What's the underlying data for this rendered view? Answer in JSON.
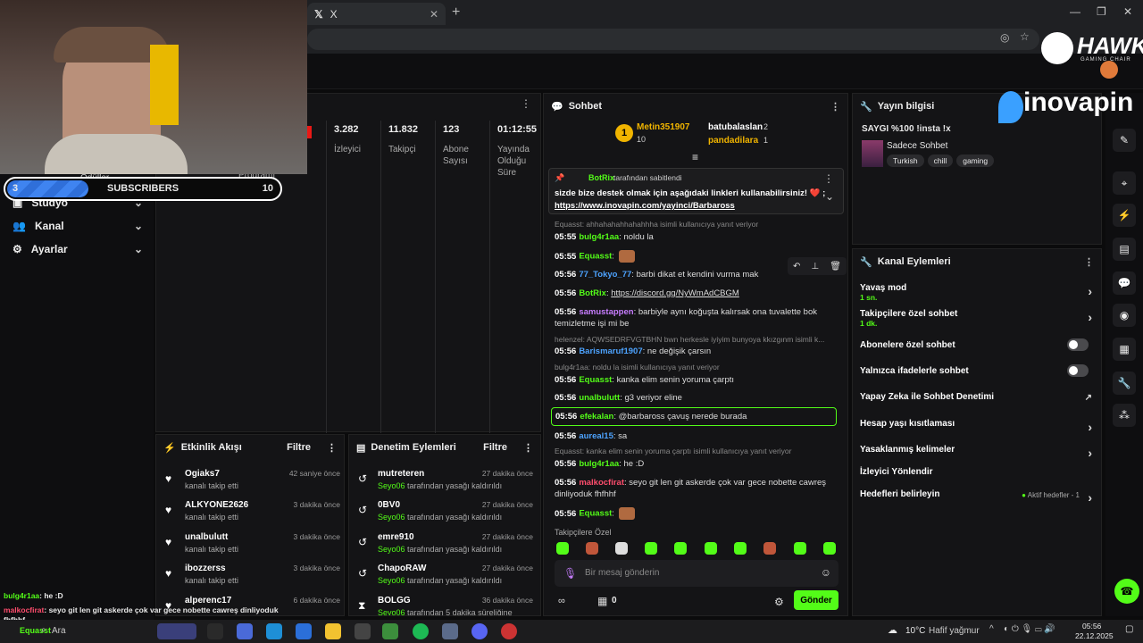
{
  "browser": {
    "tab_title": "X",
    "tab_icon": "x-logo-icon",
    "colors": {
      "accent": "#53fc18"
    }
  },
  "overlay": {
    "subscribers": {
      "current": "3",
      "label": "SUBSCRIBERS",
      "goal": "10",
      "progress_fraction": 0.3
    },
    "brand_hawk": "HAWK",
    "brand_hawk_sub": "GAMING CHAIR",
    "brand_inovapin": "inovapin",
    "chat_lines": [
      {
        "user": "bulg4r1aa",
        "text": "he :D"
      },
      {
        "user": "malkocfirat",
        "text": "seyo git len git askerde çok var gece nobette cawreş dinliyoduk fhfhhf"
      },
      {
        "user": "Equasst",
        "text": "Ala"
      }
    ]
  },
  "sidebar": {
    "partial_top": "Ödüller",
    "partial_program": "Programı",
    "items": [
      {
        "label": "Stüdyo",
        "icon": "studio-icon"
      },
      {
        "label": "Kanal",
        "icon": "people-icon"
      },
      {
        "label": "Ayarlar",
        "icon": "gear-icon"
      }
    ]
  },
  "stats": [
    {
      "value": "3.282",
      "label": "İzleyici"
    },
    {
      "value": "11.832",
      "label": "Takipçi"
    },
    {
      "value": "123",
      "label": "Abone Sayısı"
    },
    {
      "value": "01:12:55",
      "label": "Yayında Olduğu Süre"
    }
  ],
  "activity_feed": {
    "title": "Etkinlik Akışı",
    "filter": "Filtre",
    "items": [
      {
        "name": "Ogiaks7",
        "sub": "kanalı takip etti",
        "time": "42 saniye önce"
      },
      {
        "name": "ALKYONE2626",
        "sub": "kanalı takip etti",
        "time": "3 dakika önce"
      },
      {
        "name": "unalbulutt",
        "sub": "kanalı takip etti",
        "time": "3 dakika önce"
      },
      {
        "name": "ibozzerss",
        "sub": "kanalı takip etti",
        "time": "3 dakika önce"
      },
      {
        "name": "alperenc17",
        "sub": "",
        "time": "6 dakika önce"
      }
    ]
  },
  "moderation": {
    "title": "Denetim Eylemleri",
    "filter": "Filtre",
    "items": [
      {
        "name": "mutreteren",
        "by": "Seyo06",
        "action": "tarafından yasağı kaldırıldı",
        "time": "27 dakika önce"
      },
      {
        "name": "0BV0",
        "by": "Seyo06",
        "action": "tarafından yasağı kaldırıldı",
        "time": "27 dakika önce"
      },
      {
        "name": "emre910",
        "by": "Seyo06",
        "action": "tarafından yasağı kaldırıldı",
        "time": "27 dakika önce"
      },
      {
        "name": "ChapoRAW",
        "by": "Seyo06",
        "action": "tarafından yasağı kaldırıldı",
        "time": "27 dakika önce"
      },
      {
        "name": "BOLGG",
        "by": "Seyo06",
        "action": "tarafından 5 dakika süreliğine",
        "time": "36 dakika önce"
      }
    ]
  },
  "chat": {
    "title": "Sohbet",
    "top": [
      {
        "rank": "1",
        "name": "Metin351907",
        "count": "10"
      },
      {
        "name": "batubalaslan",
        "count": "2"
      },
      {
        "name": "pandadilara",
        "count": "1"
      }
    ],
    "pinned": {
      "by": "BotRix",
      "by_suffix": "tarafından sabitlendi",
      "text": "sizde bize destek olmak için aşağıdaki linkleri kullanabilirsiniz! ❤️ ;",
      "link": "https://www.inovapin.com/yayinci/Barbaross"
    },
    "messages": [
      {
        "reply": "Equasst: ahhahahahhahahhha isimli kullanıcıya yanıt veriyor"
      },
      {
        "time": "05:55",
        "user": "bulg4r1aa",
        "text": "noldu la",
        "color": "#53fc18"
      },
      {
        "time": "05:55",
        "user": "Equasst",
        "text": "",
        "color": "#53fc18"
      },
      {
        "time": "05:56",
        "user": "77_Tokyo_77",
        "text": "barbi dikat et kendini vurma mak",
        "color": "#4da3ff"
      },
      {
        "time": "05:56",
        "user": "BotRix",
        "text": "https://discord.gg/NyWmAdCBGM",
        "color": "#53fc18"
      },
      {
        "time": "05:56",
        "user": "samustappen",
        "text": "barbiyle aynı koğuşta kalırsak ona tuvalette bok temizletme işi mi be",
        "color": "#c77dff"
      },
      {
        "reply": "helenzel: AQWSEDRFVGTBHN bwn herkesle iyiyim bunyoya kkızgınm isimli k..."
      },
      {
        "time": "05:56",
        "user": "Barismaruf1907",
        "text": "ne değişik çarsın",
        "color": "#4da3ff"
      },
      {
        "reply": "bulg4r1aa: noldu la isimli kullanıcıya yanıt veriyor"
      },
      {
        "time": "05:56",
        "user": "Equasst",
        "text": "kanka elim senin yoruma çarptı",
        "color": "#53fc18"
      },
      {
        "time": "05:56",
        "user": "unalbulutt",
        "text": "g3 veriyor eline",
        "color": "#53fc18"
      },
      {
        "time": "05:56",
        "user": "efekalan",
        "text": "@barbaross çavuş nerede burada",
        "color": "#53fc18"
      },
      {
        "time": "05:56",
        "user": "aureal15",
        "text": "sa",
        "color": "#4da3ff"
      },
      {
        "reply": "Equasst: kanka elim senin yoruma çarptı isimli kullanıcıya yanıt veriyor"
      },
      {
        "time": "05:56",
        "user": "bulg4r1aa",
        "text": "he :D",
        "color": "#53fc18"
      },
      {
        "time": "05:56",
        "user": "malkocfirat",
        "text": "seyo git len git askerde çok var gece nobette cawreş dinliyoduk fhfhhf",
        "color": "#ff4d6d"
      },
      {
        "time": "05:56",
        "user": "Equasst",
        "text": "",
        "color": "#53fc18"
      }
    ],
    "emote_label": "Takipçilere Özel",
    "input_placeholder": "Bir mesaj gönderin",
    "points": "0",
    "send": "Gönder"
  },
  "stream_info": {
    "title": "Yayın bilgisi",
    "stream_title": "SAYGI %100 !insta !x",
    "category": "Sadece Sohbet",
    "tags": [
      "Turkish",
      "chill",
      "gaming"
    ]
  },
  "channel_actions": {
    "title": "Kanal Eylemleri",
    "items": [
      {
        "label": "Yavaş mod",
        "sub": "1 sn.",
        "control": "arrow"
      },
      {
        "label": "Takipçilere özel sohbet",
        "sub": "1 dk.",
        "control": "arrow"
      },
      {
        "label": "Abonelere özel sohbet",
        "sub": "",
        "control": "toggle"
      },
      {
        "label": "Yalnızca ifadelerle sohbet",
        "sub": "",
        "control": "toggle"
      },
      {
        "label": "Yapay Zeka ile Sohbet Denetimi",
        "sub": "",
        "control": "external"
      },
      {
        "label": "Hesap yaşı kısıtlaması",
        "sub": "",
        "control": "arrow"
      },
      {
        "label": "Yasaklanmış kelimeler",
        "sub": "",
        "control": "arrow"
      },
      {
        "label": "İzleyici Yönlendir",
        "sub": "",
        "control": "none"
      },
      {
        "label": "Hedefleri belirleyin",
        "sub": "Aktif hedefler - 1",
        "control": "arrow"
      }
    ]
  },
  "taskbar": {
    "search": "Ara",
    "weather_temp": "10°C",
    "weather_text": "Hafif yağmur",
    "time": "05:56",
    "date": "22.12.2025"
  }
}
